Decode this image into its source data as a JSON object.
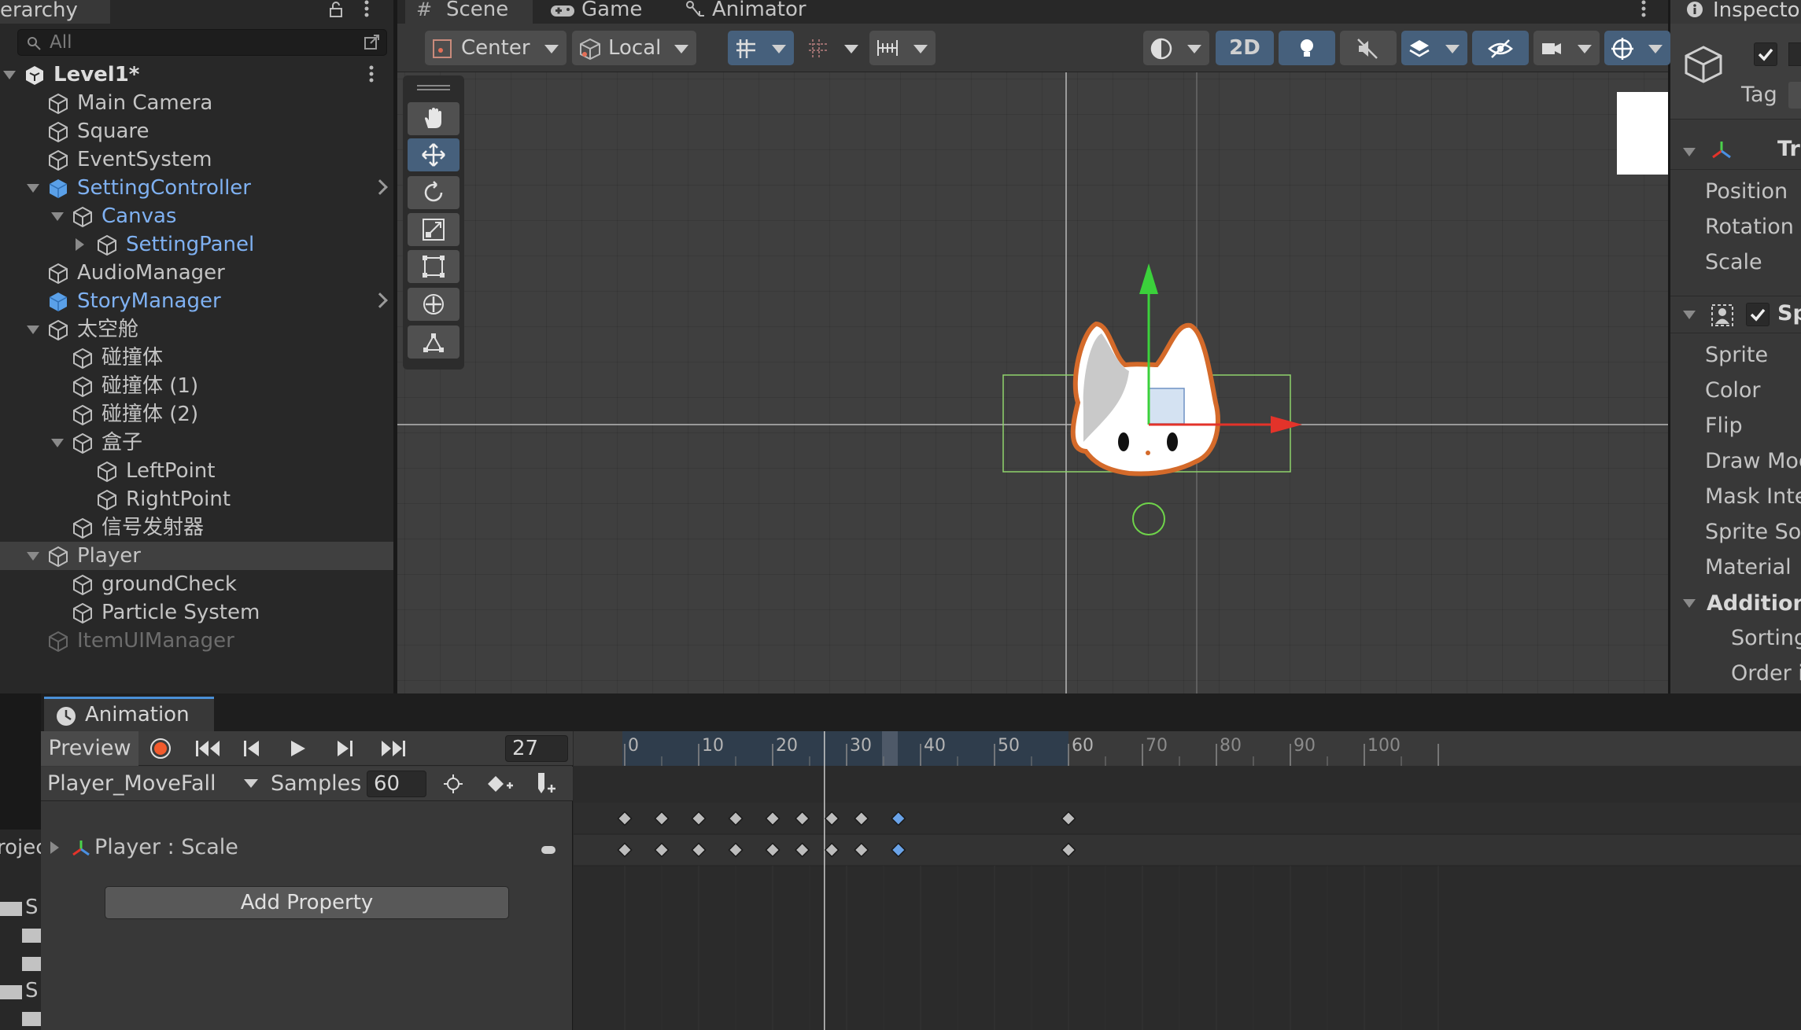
{
  "hierarchy": {
    "tab_label": "erarchy",
    "search_placeholder": "All",
    "rows": [
      {
        "label": "Level1*",
        "name": "scene-level1"
      },
      {
        "label": "Main Camera",
        "name": "tree-item-main-camera"
      },
      {
        "label": "Square",
        "name": "tree-item-square"
      },
      {
        "label": "EventSystem",
        "name": "tree-item-eventsystem"
      },
      {
        "label": "SettingController",
        "name": "tree-item-settingcontroller"
      },
      {
        "label": "Canvas",
        "name": "tree-item-canvas"
      },
      {
        "label": "SettingPanel",
        "name": "tree-item-settingpanel"
      },
      {
        "label": "AudioManager",
        "name": "tree-item-audiomanager"
      },
      {
        "label": "StoryManager",
        "name": "tree-item-storymanager"
      },
      {
        "label": "太空舱",
        "name": "tree-item-taikongcang"
      },
      {
        "label": "碰撞体",
        "name": "tree-item-collider"
      },
      {
        "label": "碰撞体 (1)",
        "name": "tree-item-collider-1"
      },
      {
        "label": "碰撞体 (2)",
        "name": "tree-item-collider-2"
      },
      {
        "label": "盒子",
        "name": "tree-item-box"
      },
      {
        "label": "LeftPoint",
        "name": "tree-item-leftpoint"
      },
      {
        "label": "RightPoint",
        "name": "tree-item-rightpoint"
      },
      {
        "label": "信号发射器",
        "name": "tree-item-signal-emitter"
      },
      {
        "label": "Player",
        "name": "tree-item-player"
      },
      {
        "label": "groundCheck",
        "name": "tree-item-groundcheck"
      },
      {
        "label": "Particle System",
        "name": "tree-item-particle-system"
      },
      {
        "label": "ItemUIManager",
        "name": "tree-item-itemuimanager"
      }
    ]
  },
  "scene": {
    "tabs": [
      "Scene",
      "Game",
      "Animator"
    ],
    "pivot_label": "Center",
    "space_label": "Local",
    "mode_2d": "2D"
  },
  "inspector": {
    "tab_label": "Inspecto",
    "tag_label": "Tag",
    "transform_header": "Tr",
    "transform_props": [
      "Position",
      "Rotation",
      "Scale"
    ],
    "sprite_header": "Sp",
    "sprite_props": [
      "Sprite",
      "Color",
      "Flip",
      "Draw Mod",
      "Mask Inte",
      "Sprite Sor",
      "Material"
    ],
    "additional_header": "Additiona",
    "additional_props": [
      "Sorting",
      "Order i"
    ]
  },
  "animation": {
    "tab_label": "Animation",
    "preview_label": "Preview",
    "current_frame": "27",
    "clip_name": "Player_MoveFall",
    "samples_label": "Samples",
    "samples_value": "60",
    "property_label": "Player : Scale",
    "add_property_label": "Add Property",
    "ruler_labels": [
      "0",
      "10",
      "20",
      "30",
      "40",
      "50",
      "60",
      "70",
      "80",
      "90",
      "100"
    ],
    "keyframes": [
      0,
      5,
      10,
      15,
      20,
      24,
      28,
      32,
      37,
      60
    ],
    "selected_keyframe": 37
  },
  "project": {
    "tab_label": "roject",
    "items": [
      "S",
      "S"
    ]
  }
}
